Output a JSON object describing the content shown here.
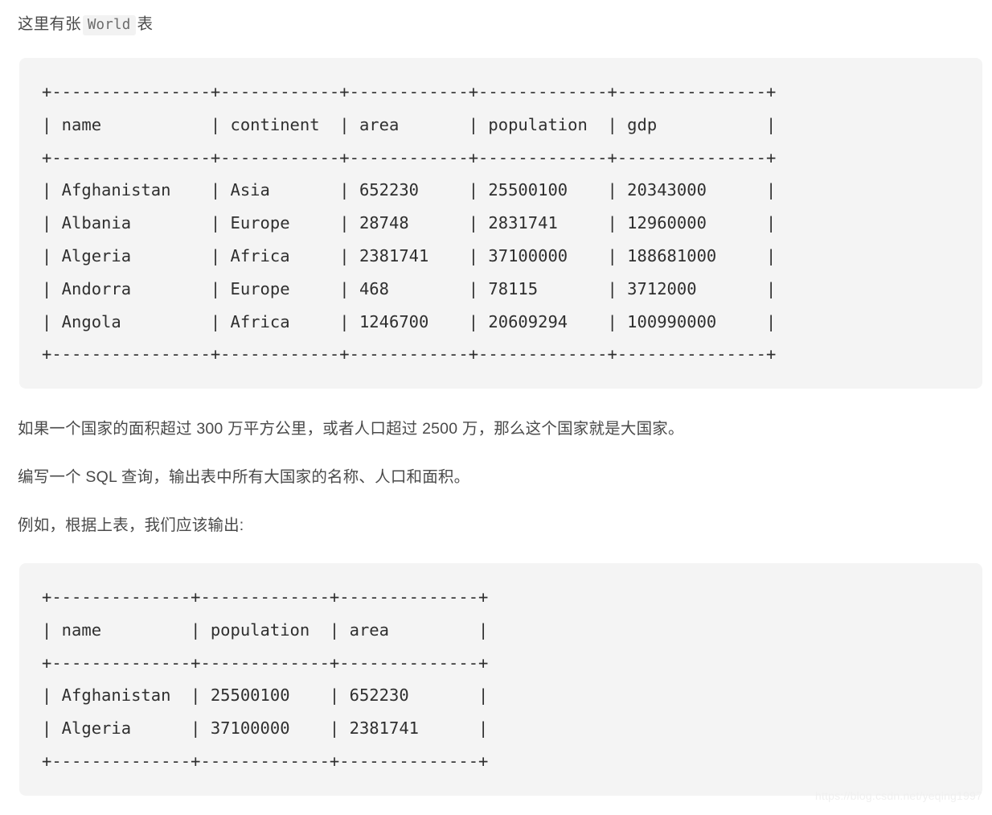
{
  "intro": {
    "before": "这里有张",
    "code": "World",
    "after": "表"
  },
  "world_table": {
    "columns": [
      "name",
      "continent",
      "area",
      "population",
      "gdp"
    ],
    "rows": [
      [
        "Afghanistan",
        "Asia",
        "652230",
        "25500100",
        "20343000"
      ],
      [
        "Albania",
        "Europe",
        "28748",
        "2831741",
        "12960000"
      ],
      [
        "Algeria",
        "Africa",
        "2381741",
        "37100000",
        "188681000"
      ],
      [
        "Andorra",
        "Europe",
        "468",
        "78115",
        "3712000"
      ],
      [
        "Angola",
        "Africa",
        "1246700",
        "20609294",
        "100990000"
      ]
    ],
    "ascii": "+----------------+------------+------------+-------------+---------------+\n| name           | continent  | area       | population  | gdp           |\n+----------------+------------+------------+-------------+---------------+\n| Afghanistan    | Asia       | 652230     | 25500100    | 20343000      |\n| Albania        | Europe     | 28748      | 2831741     | 12960000      |\n| Algeria        | Africa     | 2381741    | 37100000    | 188681000     |\n| Andorra        | Europe     | 468        | 78115       | 3712000       |\n| Angola         | Africa     | 1246700    | 20609294    | 100990000     |\n+----------------+------------+------------+-------------+---------------+"
  },
  "paragraphs": {
    "condition": "如果一个国家的面积超过 300 万平方公里，或者人口超过 2500 万，那么这个国家就是大国家。",
    "task": "编写一个 SQL 查询，输出表中所有大国家的名称、人口和面积。",
    "example_intro": "例如，根据上表，我们应该输出:"
  },
  "result_table": {
    "columns": [
      "name",
      "population",
      "area"
    ],
    "rows": [
      [
        "Afghanistan",
        "25500100",
        "652230"
      ],
      [
        "Algeria",
        "37100000",
        "2381741"
      ]
    ],
    "ascii": "+--------------+-------------+--------------+\n| name         | population  | area         |\n+--------------+-------------+--------------+\n| Afghanistan  | 25500100    | 652230       |\n| Algeria      | 37100000    | 2381741      |\n+--------------+-------------+--------------+"
  },
  "watermark": {
    "text": "https://blog.csdn.net/yeqing1997"
  },
  "colors": {
    "page_background": "#ffffff",
    "code_background": "#f4f4f4",
    "code_text": "#2f2f2f",
    "body_text": "#4a4a4a",
    "inline_code_background": "#f2f2f2",
    "inline_code_text": "#6b6b6b",
    "watermark_text": "#f0f0f0"
  }
}
